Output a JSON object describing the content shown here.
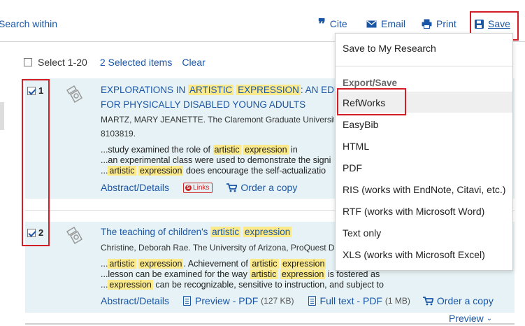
{
  "toolbar": {
    "search_within": "Search within",
    "cite": "Cite",
    "email": "Email",
    "print": "Print",
    "save": "Save"
  },
  "selection": {
    "select_label": "Select 1-20",
    "selected_items": "2 Selected items",
    "clear": "Clear"
  },
  "results": [
    {
      "number": "1",
      "title_pre": "EXPLORATIONS IN ",
      "title_hl1": "ARTISTIC",
      "title_hl2": "EXPRESSION",
      "title_post": ": AN EDU",
      "title_line2": "FOR PHYSICALLY DISABLED YOUNG ADULTS",
      "meta_line1": "MARTZ, MARY JEANETTE. The Claremont Graduate University,",
      "meta_line2": "8103819.",
      "snip1_pre": "...study examined the role of ",
      "snip1_hl1": "artistic",
      "snip1_hl2": "expression",
      "snip1_post": " in",
      "snip2": "...an experimental class were used to demonstrate the signi",
      "snip3_pre": "...",
      "snip3_hl1": "artistic",
      "snip3_hl2": "expression",
      "snip3_post": " does encourage the self-actualizatio",
      "abstract": "Abstract/Details",
      "links": "Links",
      "order": "Order a copy"
    },
    {
      "number": "2",
      "title_pre": "The teaching of children's ",
      "title_hl1": "artistic",
      "title_hl2": "expression",
      "meta_line1": "Christine, Deborah Rae. The University of Arizona, ProQuest Dis",
      "snip1_pre": "...",
      "snip1_hl1": "artistic",
      "snip1_hl2": "expression",
      "snip1_mid": ". Achievement of ",
      "snip1_hl3": "artistic",
      "snip1_hl4": "expression",
      "snip2_pre": "...lesson can be examined for the way ",
      "snip2_hl1": "artistic",
      "snip2_hl2": "expression",
      "snip2_post": " is fostered as",
      "snip3_pre": "...",
      "snip3_hl1": "expression",
      "snip3_post": " can be recognizable, sensitive to instruction, and subject to",
      "abstract": "Abstract/Details",
      "preview_pdf": "Preview - PDF",
      "preview_size": "(127 KB)",
      "fulltext_pdf": "Full text - PDF",
      "fulltext_size": "(1 MB)",
      "order": "Order a copy",
      "preview": "Preview"
    }
  ],
  "save_menu": {
    "save_to_research": "Save to My Research",
    "export_header": "Export/Save",
    "items": [
      "RefWorks",
      "EasyBib",
      "HTML",
      "PDF",
      "RIS (works with EndNote, Citavi, etc.)",
      "RTF (works with Microsoft Word)",
      "Text only",
      "XLS (works with Microsoft Excel)"
    ]
  },
  "colors": {
    "link": "#1a56a6",
    "highlight": "#fbe98a",
    "record_bg": "#e6f2f5",
    "annotation_red": "#d21f27"
  }
}
